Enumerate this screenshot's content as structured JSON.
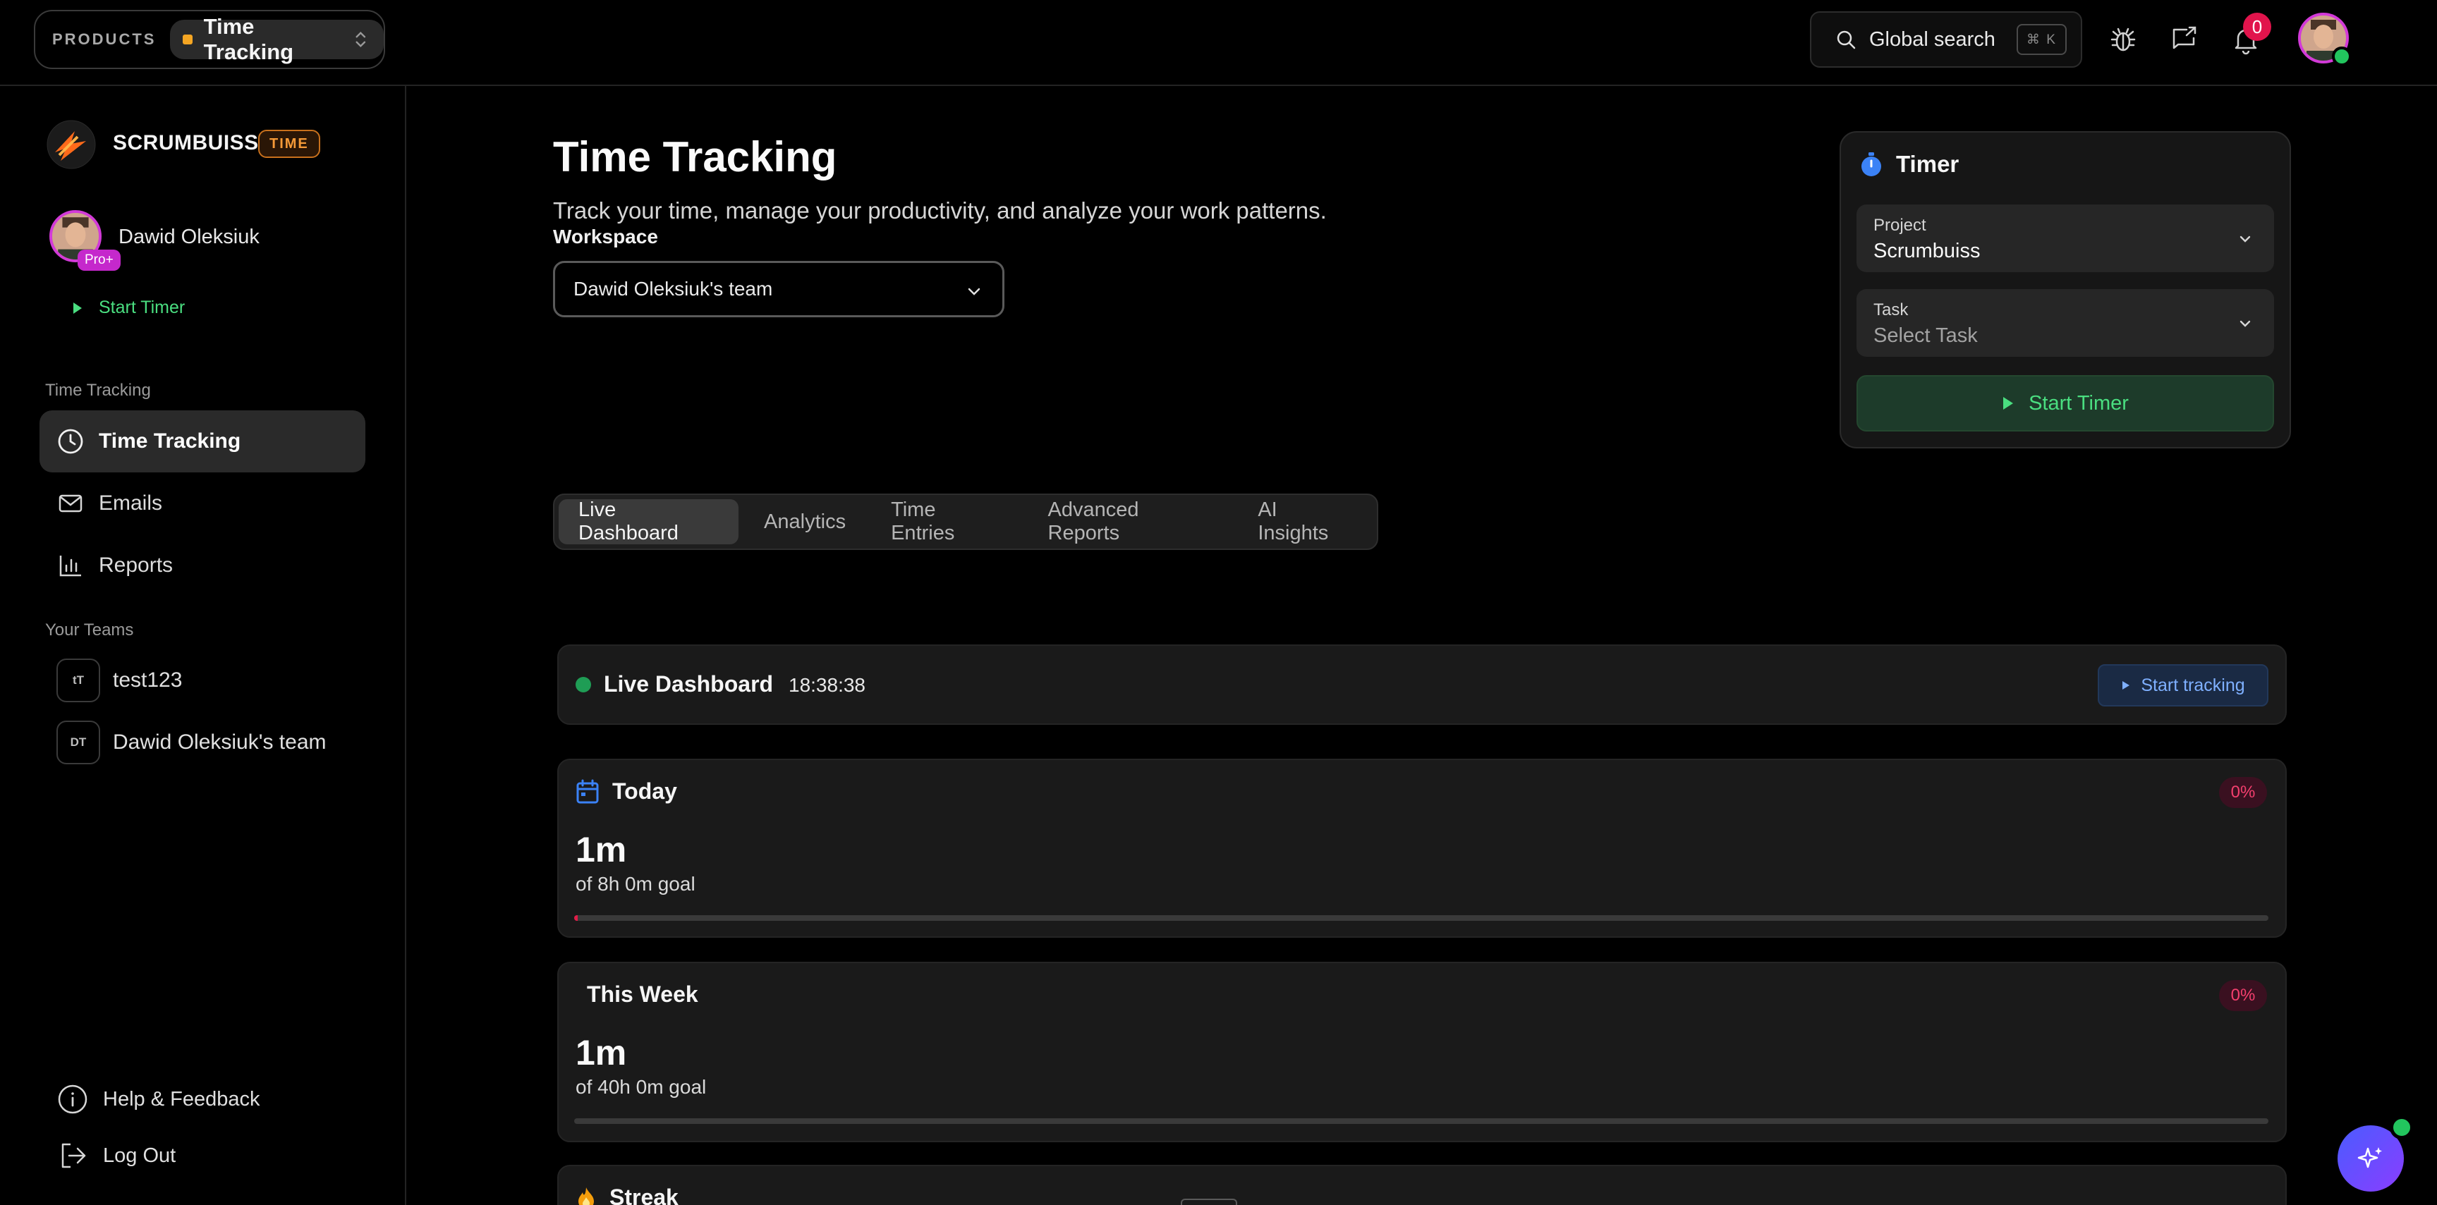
{
  "topbar": {
    "products_label": "PRODUCTS",
    "current_product": "Time Tracking",
    "search_label": "Global search",
    "search_shortcut": "⌘ K",
    "notification_count": "0"
  },
  "sidebar": {
    "brand_name": "SCRUMBUISS",
    "brand_tag": "TIME",
    "user_name": "Dawid Oleksiuk",
    "user_plan": "Pro+",
    "start_timer": "Start Timer",
    "section_time_tracking": "Time Tracking",
    "nav": [
      {
        "label": "Time Tracking",
        "icon": "clock-icon",
        "active": true
      },
      {
        "label": "Emails",
        "icon": "mail-icon",
        "active": false
      },
      {
        "label": "Reports",
        "icon": "bar-chart-icon",
        "active": false
      }
    ],
    "section_teams": "Your Teams",
    "teams": [
      {
        "initials": "tT",
        "name": "test123"
      },
      {
        "initials": "DT",
        "name": "Dawid Oleksiuk's team"
      }
    ],
    "footer": {
      "help": "Help & Feedback",
      "logout": "Log Out"
    }
  },
  "main": {
    "title": "Time Tracking",
    "subtitle": "Track your time, manage your productivity, and analyze your work patterns.",
    "workspace_label": "Workspace",
    "workspace_value": "Dawid Oleksiuk's team",
    "tabs": [
      {
        "label": "Live Dashboard",
        "active": true
      },
      {
        "label": "Analytics",
        "active": false
      },
      {
        "label": "Time Entries",
        "active": false
      },
      {
        "label": "Advanced Reports",
        "active": false
      },
      {
        "label": "AI Insights",
        "active": false
      }
    ]
  },
  "timer": {
    "title": "Timer",
    "project_label": "Project",
    "project_value": "Scrumbuiss",
    "task_label": "Task",
    "task_placeholder": "Select Task",
    "start_label": "Start Timer"
  },
  "dashboard": {
    "title": "Live Dashboard",
    "clock": "18:38:38",
    "start_tracking": "Start tracking",
    "today": {
      "title": "Today",
      "value": "1m",
      "goal": "of 8h 0m goal",
      "percent": "0%",
      "progress_fraction": 0.002
    },
    "week": {
      "title": "This Week",
      "value": "1m",
      "goal": "of 40h 0m goal",
      "percent": "0%",
      "progress_fraction": 0.0
    },
    "streak": {
      "title": "Streak"
    }
  },
  "colors": {
    "accent_green": "#4ade80",
    "accent_orange": "#f5a623",
    "accent_pink": "#e1144c",
    "accent_blue": "#3b82f6"
  }
}
